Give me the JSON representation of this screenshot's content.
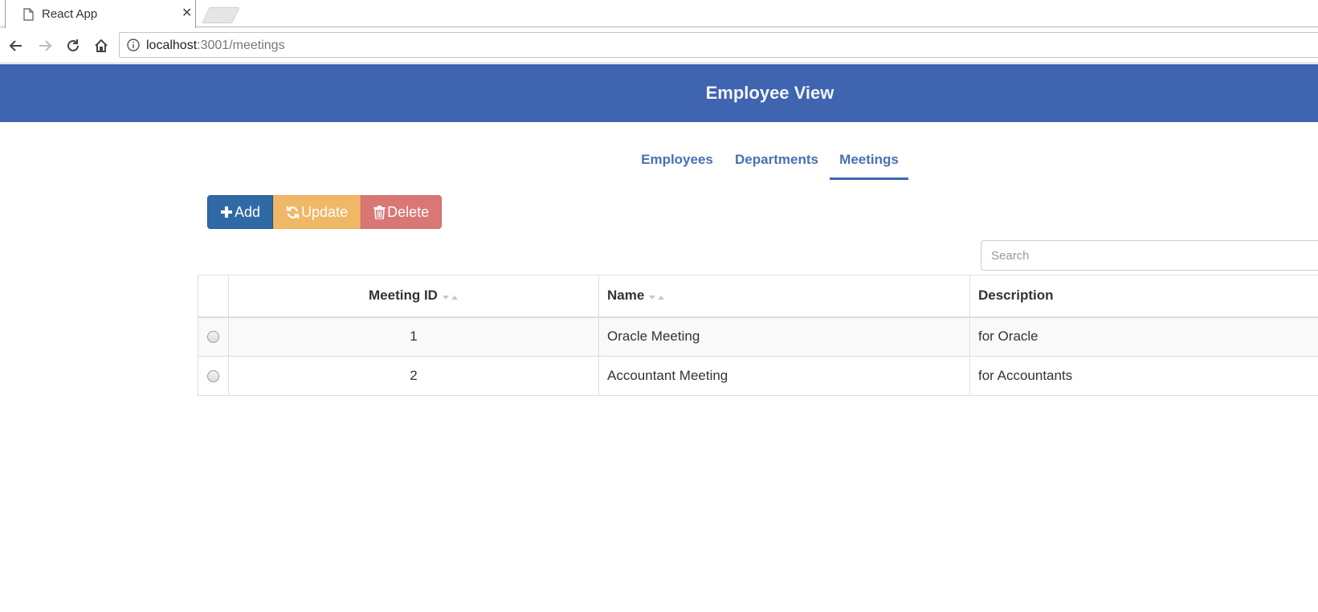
{
  "browser": {
    "tab_title": "React App",
    "close_glyph": "✕",
    "url_host": "localhost",
    "url_rest": ":3001/meetings"
  },
  "header": {
    "title": "Employee View",
    "background": "#3f64b0"
  },
  "nav": {
    "tabs": [
      {
        "label": "Employees",
        "active": false
      },
      {
        "label": "Departments",
        "active": false
      },
      {
        "label": "Meetings",
        "active": true
      }
    ]
  },
  "toolbar": {
    "add_label": "Add",
    "add_icon": "plus-icon",
    "update_label": "Update",
    "update_icon": "refresh-icon",
    "delete_label": "Delete",
    "delete_icon": "trash-icon",
    "colors": {
      "add": "#2f6aa6",
      "update": "#f0b866",
      "delete": "#d97775"
    }
  },
  "search": {
    "placeholder": "Search",
    "value": ""
  },
  "table": {
    "columns": [
      "Meeting ID",
      "Name",
      "Description"
    ],
    "rows": [
      {
        "id": "1",
        "name": "Oracle Meeting",
        "description": "for Oracle"
      },
      {
        "id": "2",
        "name": "Accountant Meeting",
        "description": "for Accountants"
      }
    ]
  }
}
